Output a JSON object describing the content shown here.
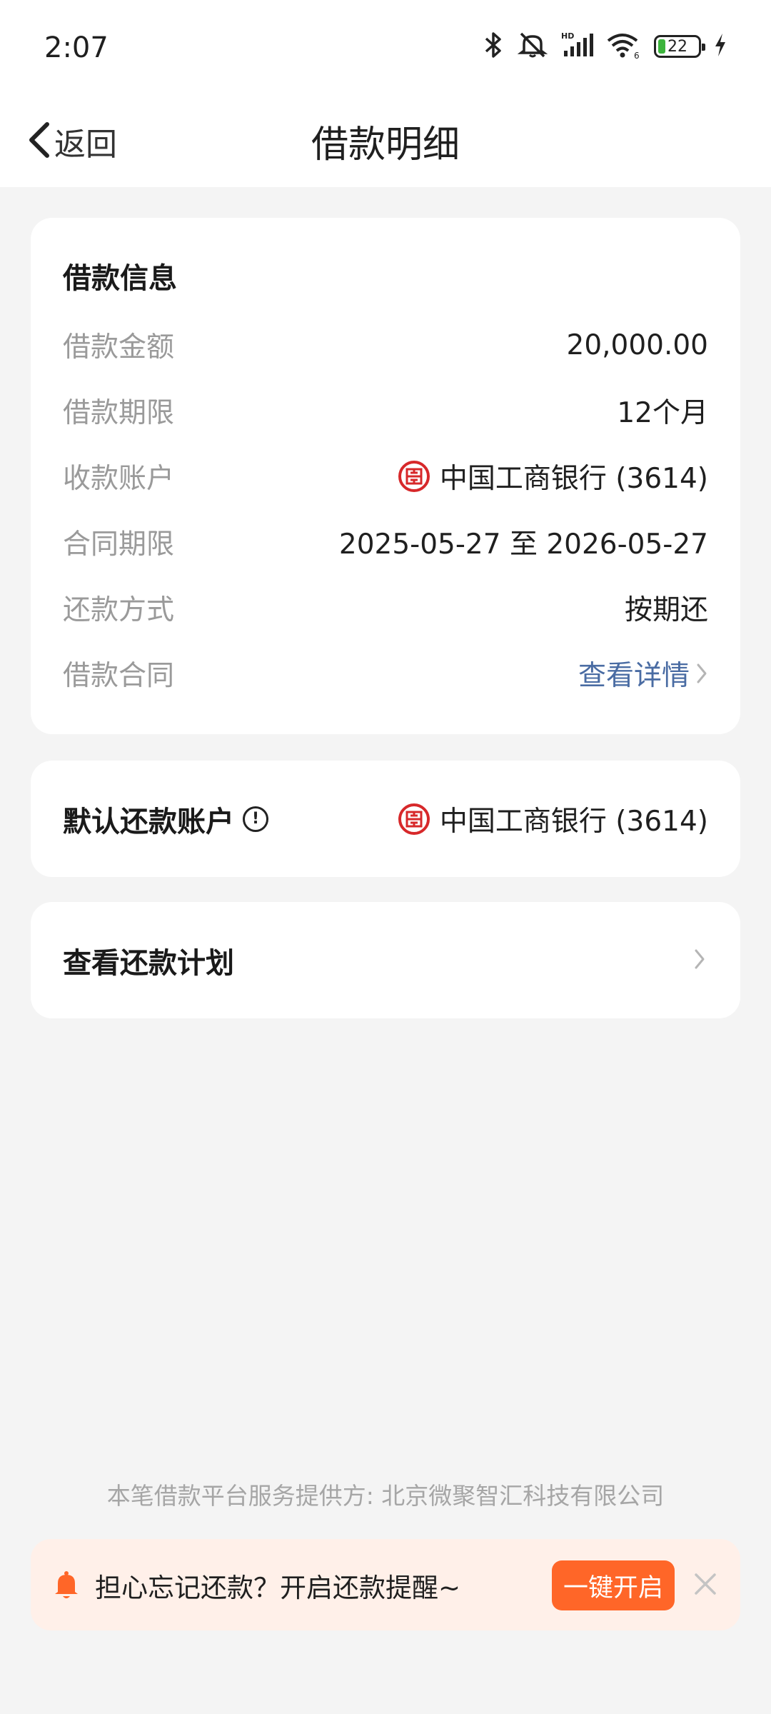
{
  "status_bar": {
    "time": "2:07",
    "battery": "22"
  },
  "nav": {
    "back_label": "返回",
    "title": "借款明细"
  },
  "loan_info": {
    "title": "借款信息",
    "rows": [
      {
        "label": "借款金额",
        "value": "20,000.00"
      },
      {
        "label": "借款期限",
        "value": "12个月"
      },
      {
        "label": "收款账户",
        "value": "中国工商银行 (3614)"
      },
      {
        "label": "合同期限",
        "value": "2025-05-27 至 2026-05-27"
      },
      {
        "label": "还款方式",
        "value": "按期还"
      },
      {
        "label": "借款合同",
        "value": "查看详情"
      }
    ]
  },
  "default_account": {
    "label": "默认还款账户",
    "value": "中国工商银行 (3614)"
  },
  "repayment_plan": {
    "label": "查看还款计划"
  },
  "footer": {
    "provider_note": "本笔借款平台服务提供方: 北京微聚智汇科技有限公司"
  },
  "reminder": {
    "text": "担心忘记还款？开启还款提醒~",
    "button_label": "一键开启"
  },
  "colors": {
    "accent_orange": "#ff6628",
    "link_blue": "#4a6ca3",
    "bank_red": "#d7282a",
    "reminder_bg": "#fff0e9"
  }
}
